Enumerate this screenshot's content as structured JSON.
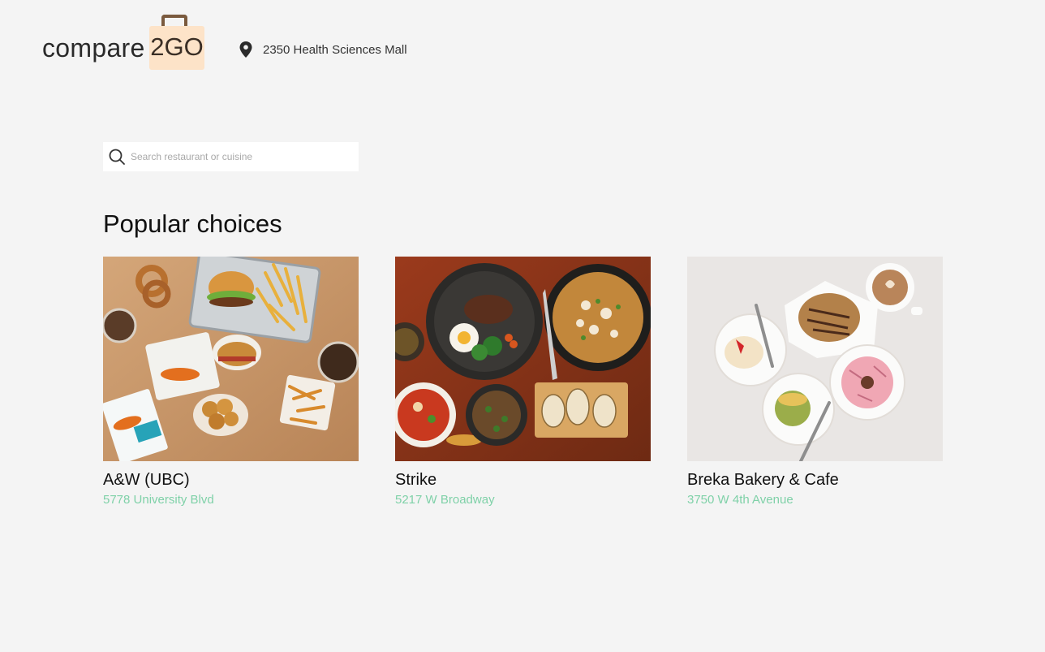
{
  "brand": {
    "word": "compare",
    "badge": "2GO",
    "bag_color": "#fde3c8",
    "handle_color": "#7a5a3e"
  },
  "location": {
    "icon": "map-pin-icon",
    "address": "2350 Health Sciences Mall"
  },
  "search": {
    "icon": "search-icon",
    "placeholder": "Search restaurant or cuisine",
    "value": ""
  },
  "popular": {
    "title": "Popular choices",
    "accent_color": "#7fd1a8",
    "restaurants": [
      {
        "name": "A&W (UBC)",
        "address": "5778 University Blvd",
        "image": "aw-food-photo"
      },
      {
        "name": "Strike",
        "address": "5217 W Broadway",
        "image": "strike-food-photo"
      },
      {
        "name": "Breka Bakery & Cafe",
        "address": "3750 W 4th Avenue",
        "image": "breka-food-photo"
      }
    ]
  }
}
